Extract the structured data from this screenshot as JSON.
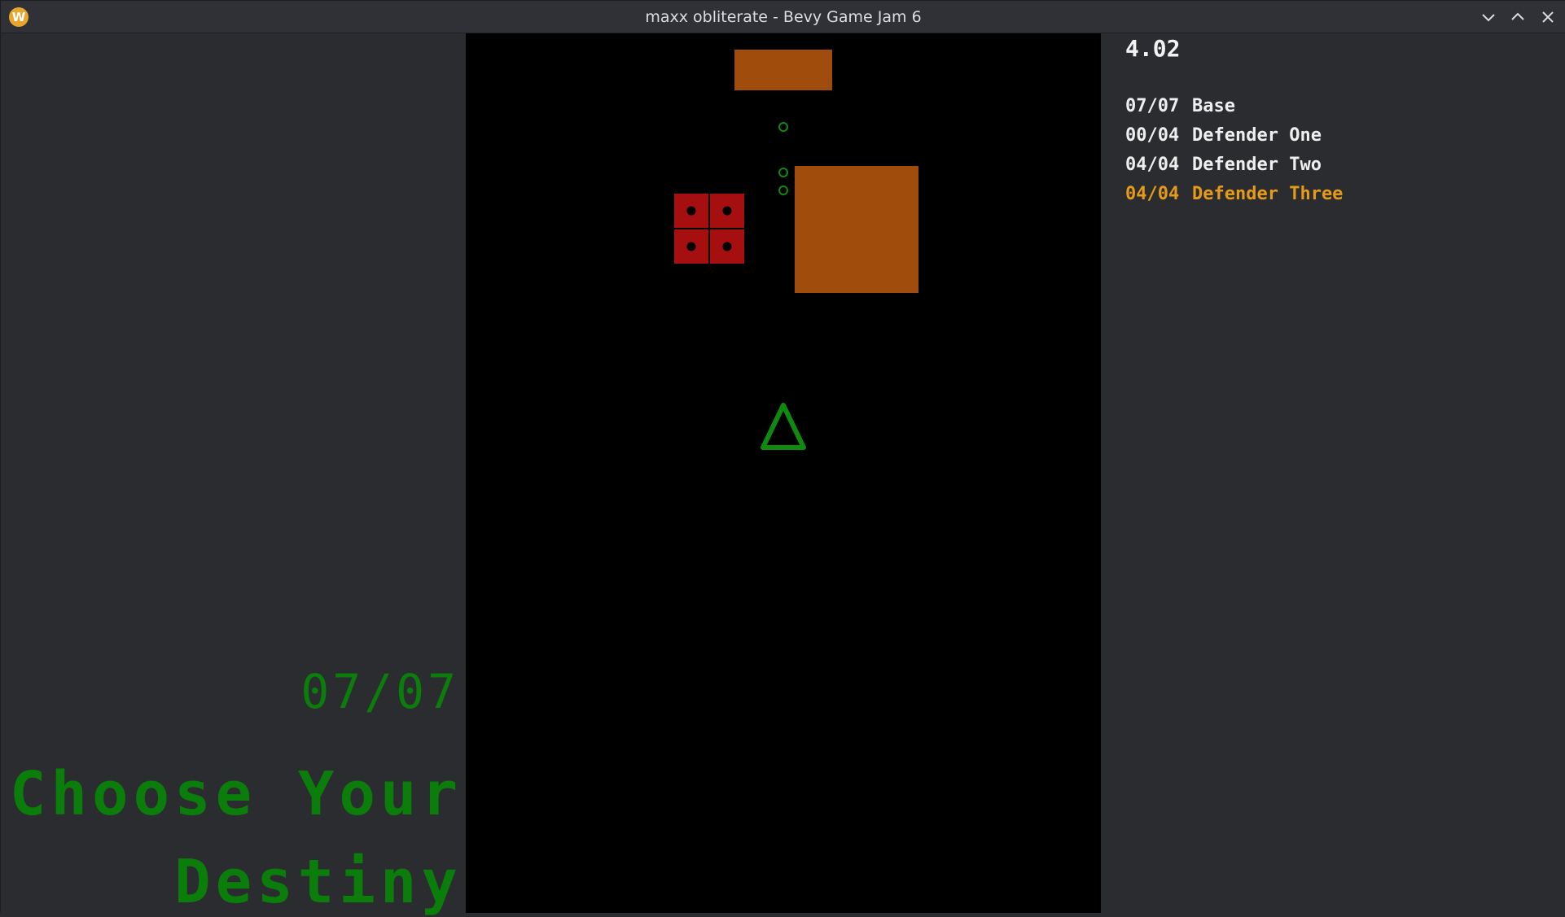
{
  "window": {
    "title": "maxx obliterate - Bevy Game Jam 6",
    "app_icon_letter": "W",
    "app_icon_color": "#e8a72c",
    "controls": {
      "minimize_icon": "chevron-down-icon",
      "maximize_icon": "chevron-up-icon",
      "close_icon": "close-icon"
    }
  },
  "left_panel": {
    "progress": "07/07",
    "message_line1": "Choose Your",
    "message_line2": "Destiny",
    "text_color": "#0a7d0a"
  },
  "hud": {
    "timer": "4.02",
    "stages": [
      {
        "count": "07/07",
        "name": "Base",
        "active": false
      },
      {
        "count": "00/04",
        "name": "Defender One",
        "active": false
      },
      {
        "count": "04/04",
        "name": "Defender Two",
        "active": false
      },
      {
        "count": "04/04",
        "name": "Defender Three",
        "active": true
      }
    ],
    "active_color": "#e69a1a",
    "text_color": "#efefef"
  },
  "arena": {
    "background": "#000000",
    "block_color": "#a04c0d",
    "dice_color": "#a50f0f",
    "player_color": "#0f8a0f",
    "bullet_color": "#0f8a0f"
  }
}
